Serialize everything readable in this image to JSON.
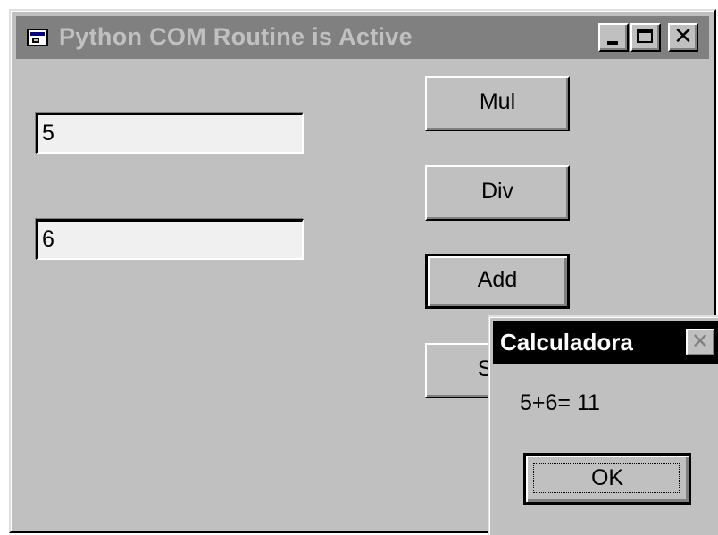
{
  "main_window": {
    "title": "Python COM Routine is Active",
    "controls": {
      "minimize": "minimize",
      "maximize": "maximize",
      "close_glyph": "✕"
    },
    "inputs": [
      {
        "value": "5"
      },
      {
        "value": "6"
      }
    ],
    "buttons": {
      "mul": "Mul",
      "div": "Div",
      "add": "Add",
      "sub": "Sub"
    }
  },
  "msgbox": {
    "title": "Calculadora",
    "close_glyph": "✕",
    "message": "5+6= 11",
    "ok_label": "OK"
  },
  "colors": {
    "window_bg": "#c0c0c0",
    "inactive_titlebar": "#808080",
    "active_titlebar": "#000000"
  },
  "icons": [
    "app-window-icon",
    "minimize-icon",
    "maximize-icon",
    "close-icon"
  ]
}
